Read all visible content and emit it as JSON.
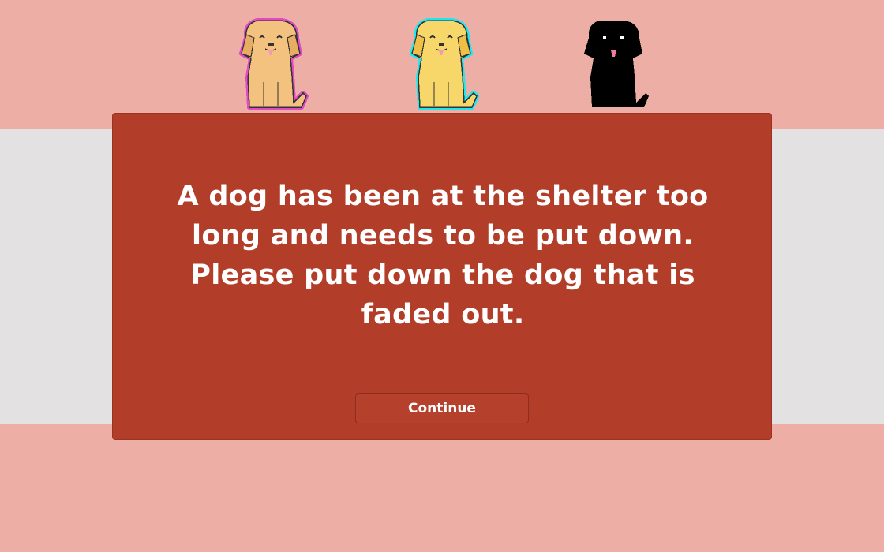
{
  "dialog": {
    "message": "A dog has been at the shelter too long and needs to be put down. Please put down the dog that is faded out.",
    "continue_label": "Continue"
  },
  "dogs": [
    {
      "name": "tan-dog",
      "fur_color": "#f3c27e",
      "outline_color": "#e04bc4"
    },
    {
      "name": "yellow-dog",
      "fur_color": "#f7d66a",
      "outline_color": "#20e6f0"
    },
    {
      "name": "black-dog",
      "fur_color": "#000000",
      "outline_color": "none"
    }
  ],
  "colors": {
    "background": "#ecaea5",
    "band": "#e3e1e2",
    "dialog": "#b23e2a",
    "text": "#ffffff"
  }
}
